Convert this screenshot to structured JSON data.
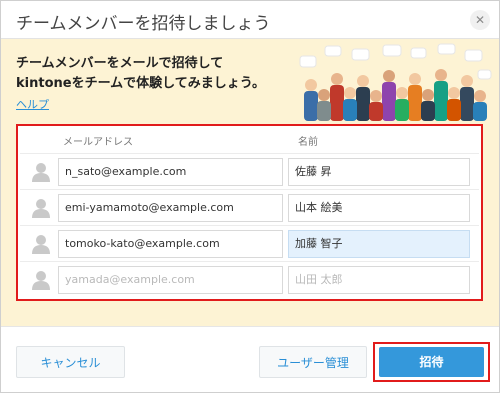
{
  "dialog": {
    "title": "チームメンバーを招待しましょう",
    "close_symbol": "✕"
  },
  "banner": {
    "headline_line1": "チームメンバーをメールで招待して",
    "headline_line2": "kintoneをチームで体験してみましょう。",
    "help_link": "ヘルプ"
  },
  "table": {
    "column_email": "メールアドレス",
    "column_name": "名前",
    "rows": [
      {
        "email": "n_sato@example.com",
        "name": "佐藤 昇"
      },
      {
        "email": "emi-yamamoto@example.com",
        "name": "山本 絵美"
      },
      {
        "email": "tomoko-kato@example.com",
        "name": "加藤 智子"
      },
      {
        "email_placeholder": "yamada@example.com",
        "name_placeholder": "山田 太郎"
      }
    ]
  },
  "footer": {
    "cancel": "キャンセル",
    "user_management": "ユーザー管理",
    "invite": "招待"
  },
  "colors": {
    "banner_bg": "#fdf3d4",
    "accent_blue": "#3498db",
    "link_blue": "#2a8fd6",
    "highlight_red": "#e11b1b"
  }
}
